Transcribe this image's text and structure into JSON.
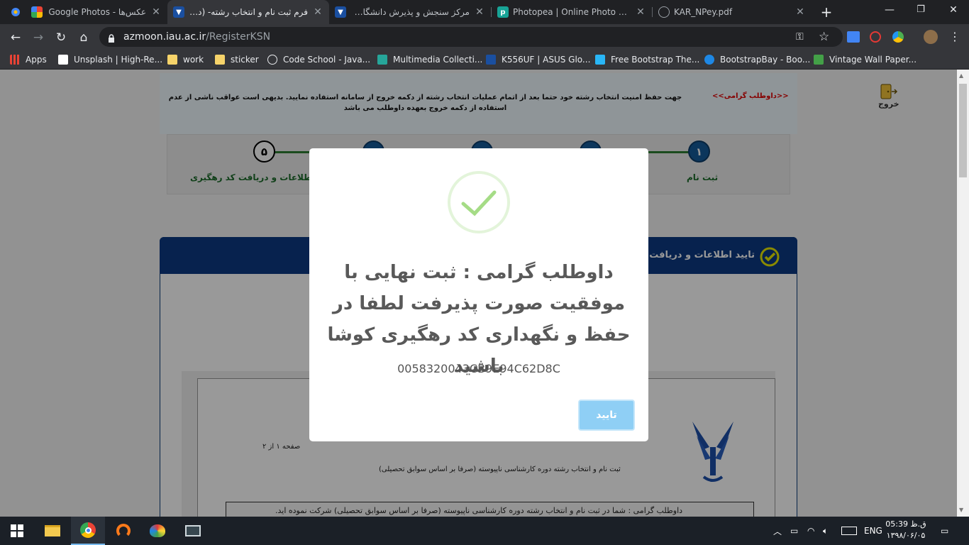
{
  "browser": {
    "tabs": [
      {
        "label": "عکس‌ها - Google Photos",
        "icon": "google-photos-icon"
      },
      {
        "label": "فرم ثبت نام و انتخاب رشته- (دانشگاه",
        "icon": "iau-favicon"
      },
      {
        "label": "مرکز سنجش و پذیرش دانشگاه آزاد",
        "icon": "iau-favicon"
      },
      {
        "label": "Photopea | Online Photo Editor",
        "icon": "photopea-icon"
      },
      {
        "label": "KAR_NPey.pdf",
        "icon": "globe-icon"
      }
    ],
    "new_tab": "+",
    "url_host": "azmoon.iau.ac.ir",
    "url_path": "/RegisterKSN",
    "bookmarks": [
      {
        "label": "Apps",
        "icon": "apps-grid-icon"
      },
      {
        "label": "Unsplash | High-Re...",
        "icon": "unsplash-icon"
      },
      {
        "label": "work",
        "icon": "folder-icon"
      },
      {
        "label": "sticker",
        "icon": "folder-icon"
      },
      {
        "label": "Code School - Java...",
        "icon": "globe-icon"
      },
      {
        "label": "Multimedia Collecti...",
        "icon": "bookmark-icon"
      },
      {
        "label": "K556UF | ASUS Glo...",
        "icon": "asus-icon"
      },
      {
        "label": "Free Bootstrap The...",
        "icon": "bookmark-icon"
      },
      {
        "label": "BootstrapBay - Boo...",
        "icon": "bookmark-icon"
      },
      {
        "label": "Vintage Wall Paper...",
        "icon": "bookmark-icon"
      }
    ]
  },
  "page": {
    "notice_title": "<<داوطلب گرامی>>",
    "notice_body": "جهت حفظ امنیت انتخاب رشته خود حتما بعد از اتمام عملیات انتخاب رشته از دکمه خروج از سامانه استفاده نمایید. بدیهی است عواقب ناشی از عدم استفاده از دکمه خروج بعهده داوطلب می باشد",
    "exit_label": "خروج",
    "steps": [
      {
        "number": "۱",
        "label": "ثبت نام",
        "state": "done"
      },
      {
        "number": "۲",
        "label": "",
        "state": "done"
      },
      {
        "number": "۳",
        "label": "",
        "state": "done"
      },
      {
        "number": "۴",
        "label": "",
        "state": "done"
      },
      {
        "number": "۵",
        "label": "تایید اطلاعات و دریافت کد رهگیری",
        "state": "open"
      }
    ],
    "panel_title": "تایید اطلاعات و دریافت کد رهگیری",
    "doc_page": "صفحه ۱ از ۲",
    "doc_line": "(ثبت نام و انتخاب رشته دوره کارشناسی ناپیوسته (صرفا بر اساس سوابق تحصیلی",
    "doc_box": "داوطلب گرامی : شما در ثبت نام و انتخاب رشته دوره کارشناسی ناپیوسته (صرفا بر اساس سوابق تحصیلی) شرکت نموده اید."
  },
  "modal": {
    "title": "داوطلب گرامی : ثبت نهایی با موفقیت صورت پذیرفت لطفا در حفظ و نگهداری کد رهگیری کوشا باشید",
    "tracking_code": "0058320043CB9E94C62D8C",
    "confirm_label": "تایید",
    "accent_color": "#8fcff5",
    "success_color": "#a5dc86"
  },
  "taskbar": {
    "language": "ENG",
    "time": "05:39 ق.ظ",
    "date": "۱۳۹۸/۰۶/۰۵"
  }
}
